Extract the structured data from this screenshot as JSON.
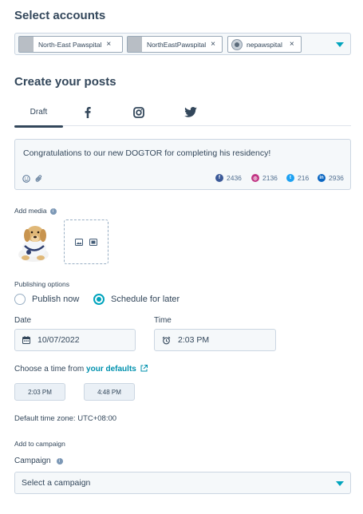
{
  "accounts": {
    "heading": "Select accounts",
    "chips": [
      {
        "label": "North-East Pawspital",
        "remove": "×"
      },
      {
        "label": "NorthEastPawspital",
        "remove": "×"
      },
      {
        "label": "nepawspital",
        "remove": "×"
      }
    ]
  },
  "create": {
    "heading": "Create your posts",
    "tabs": [
      {
        "label": "Draft",
        "active": true
      },
      {
        "label": "",
        "icon": "facebook-icon"
      },
      {
        "label": "",
        "icon": "instagram-icon"
      },
      {
        "label": "",
        "icon": "twitter-icon"
      }
    ]
  },
  "composer": {
    "text": "Congratulations to our new DOGTOR for completing his residency!",
    "counts": [
      {
        "icon": "facebook-icon",
        "color": "#3b5998",
        "value": "2436"
      },
      {
        "icon": "instagram-icon",
        "color": "#c13584",
        "value": "2136"
      },
      {
        "icon": "twitter-icon",
        "color": "#1da1f2",
        "value": "216"
      },
      {
        "icon": "linkedin-icon",
        "color": "#0a66c2",
        "value": "2936"
      }
    ]
  },
  "media": {
    "label": "Add media"
  },
  "publishing": {
    "label": "Publishing options",
    "options": [
      {
        "label": "Publish now",
        "selected": false
      },
      {
        "label": "Schedule for later",
        "selected": true
      }
    ]
  },
  "date": {
    "label": "Date",
    "value": "10/07/2022"
  },
  "time": {
    "label": "Time",
    "value": "2:03 PM"
  },
  "defaults": {
    "prefix": "Choose a time from ",
    "link": "your defaults",
    "times": [
      "2:03 PM",
      "4:48 PM"
    ],
    "timezone": "Default time zone: UTC+08:00"
  },
  "campaign": {
    "section_label": "Add to campaign",
    "label": "Campaign",
    "placeholder": "Select a campaign"
  },
  "colors": {
    "accent": "#00a4bd",
    "text": "#33475b",
    "link": "#0091ae"
  }
}
